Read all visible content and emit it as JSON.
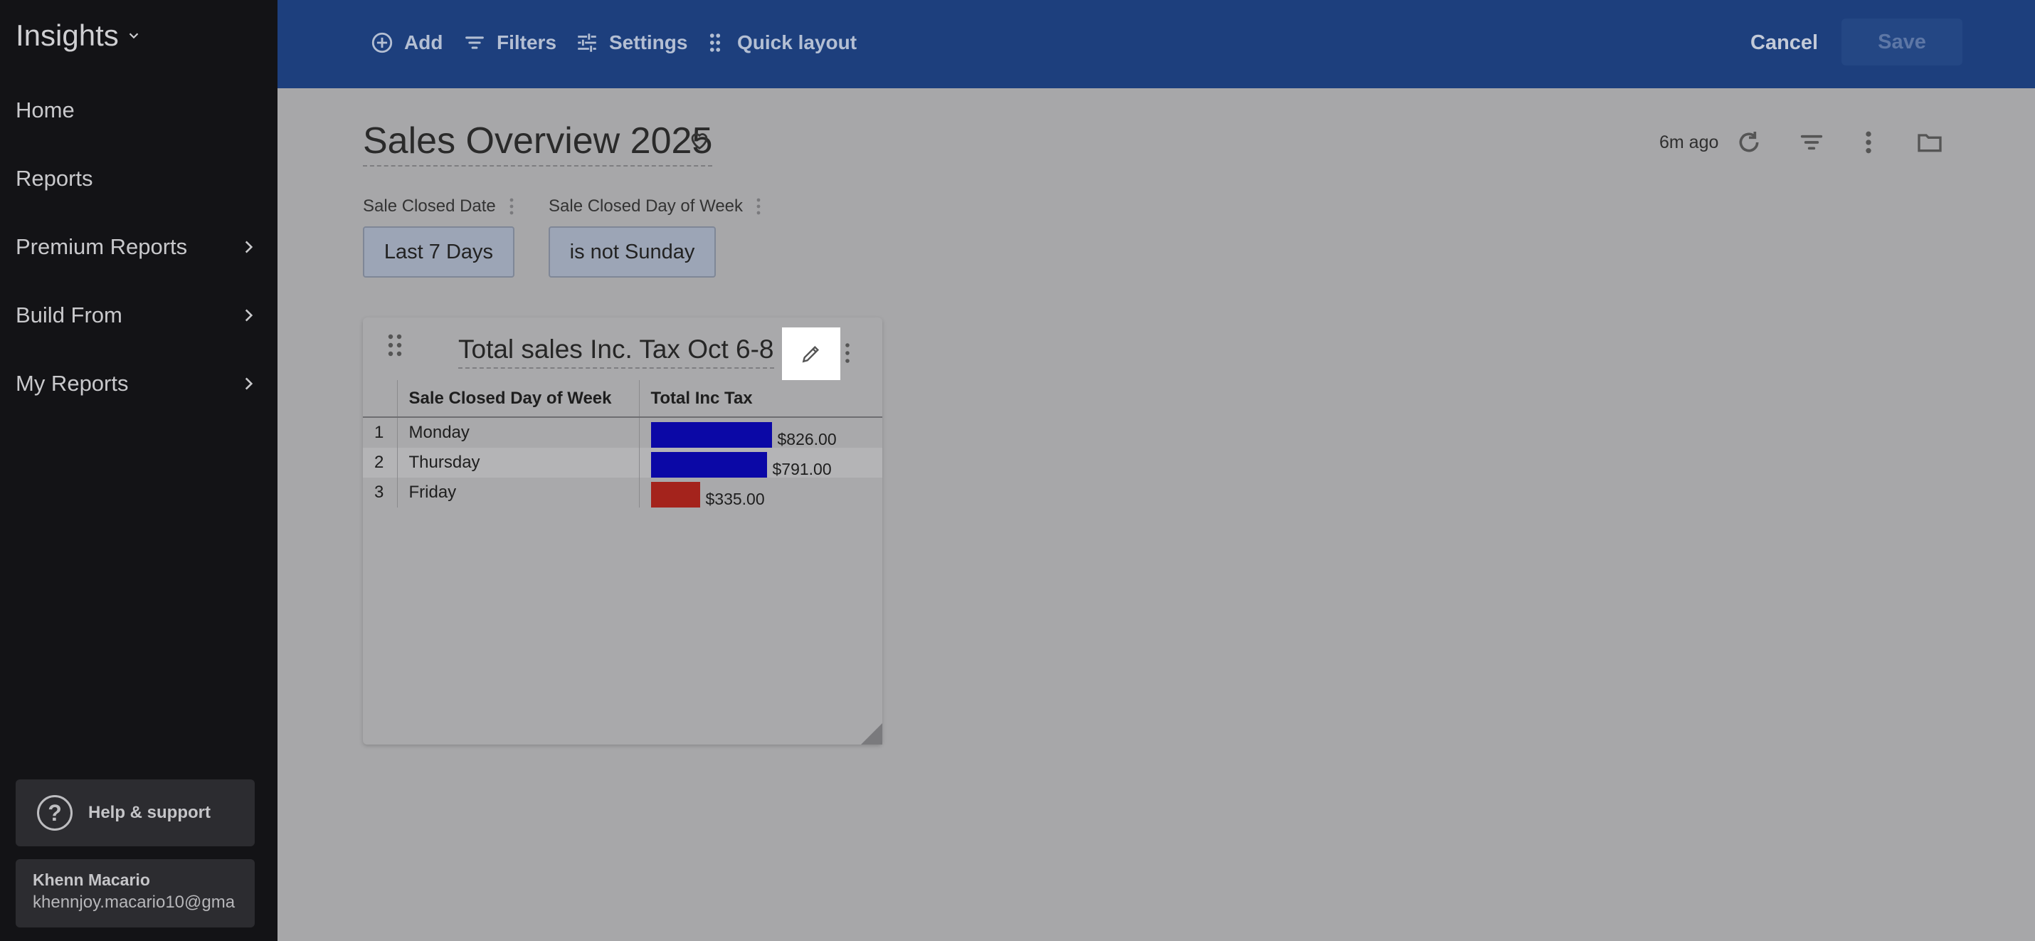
{
  "sidebar": {
    "brand": "Insights",
    "items": [
      {
        "label": "Home",
        "chevron": false
      },
      {
        "label": "Reports",
        "chevron": false
      },
      {
        "label": "Premium Reports",
        "chevron": true
      },
      {
        "label": "Build From",
        "chevron": true
      },
      {
        "label": "My Reports",
        "chevron": true
      }
    ],
    "help_label": "Help & support",
    "user": {
      "name": "Khenn Macario",
      "email": "khennjoy.macario10@gma"
    }
  },
  "toolbar": {
    "add_label": "Add",
    "filters_label": "Filters",
    "settings_label": "Settings",
    "quick_layout_label": "Quick layout",
    "cancel_label": "Cancel",
    "save_label": "Save"
  },
  "dashboard": {
    "title": "Sales Overview 2025",
    "updated": "6m ago",
    "filters": [
      {
        "label": "Sale Closed Date",
        "value": "Last 7 Days"
      },
      {
        "label": "Sale Closed Day of Week",
        "value": "is not Sunday"
      }
    ]
  },
  "tile": {
    "title": "Total sales Inc. Tax Oct 6-8",
    "columns": [
      "Sale Closed Day of Week",
      "Total Inc Tax"
    ],
    "rows": [
      {
        "index": "1",
        "day": "Monday",
        "value": 826.0,
        "display": "$826.00",
        "color": "#0b08a6"
      },
      {
        "index": "2",
        "day": "Thursday",
        "value": 791.0,
        "display": "$791.00",
        "color": "#0b08a6"
      },
      {
        "index": "3",
        "day": "Friday",
        "value": 335.0,
        "display": "$335.00",
        "color": "#a4231c"
      }
    ]
  },
  "colors": {
    "topbar": "#1d3f7d",
    "sidebar": "#131316",
    "bar_high": "#0b08a6",
    "bar_low": "#a4231c"
  }
}
